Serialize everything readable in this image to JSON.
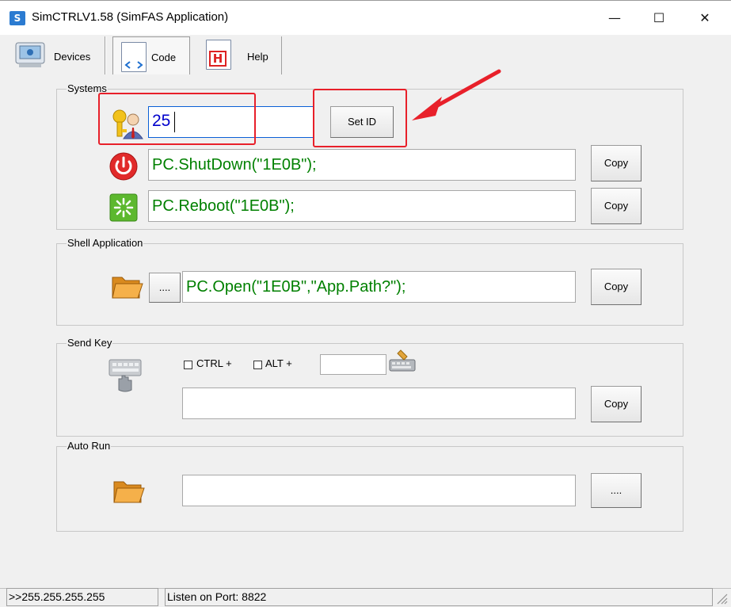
{
  "window": {
    "title": "SimCTRLV1.58 (SimFAS Application)",
    "icon_glyph": "S",
    "minimize": "—",
    "maximize": "☐",
    "close": "✕"
  },
  "toolbar": {
    "devices": "Devices",
    "code": "Code",
    "help": "Help",
    "help_icon_glyph": "H"
  },
  "systems": {
    "group_label": "Systems",
    "id_value": "25",
    "set_id_label": "Set ID",
    "shutdown_code": "PC.ShutDown(\"1E0B\");",
    "reboot_code": "PC.Reboot(\"1E0B\");",
    "copy_label": "Copy"
  },
  "shell": {
    "group_label": "Shell Application",
    "browse_label": "....",
    "open_code": "PC.Open(\"1E0B\",\"App.Path?\");",
    "copy_label": "Copy"
  },
  "sendkey": {
    "group_label": "Send Key",
    "ctrl_label": "CTRL +",
    "alt_label": "ALT +",
    "key_value": "",
    "code_value": "",
    "copy_label": "Copy"
  },
  "autorun": {
    "group_label": "Auto Run",
    "path_value": "",
    "browse_label": "...."
  },
  "status": {
    "address": ">>255.255.255.255",
    "port": "Listen on Port: 8822"
  },
  "colors": {
    "code_text": "#008000",
    "annotation_red": "#e8202a",
    "id_text": "#0000cc"
  }
}
